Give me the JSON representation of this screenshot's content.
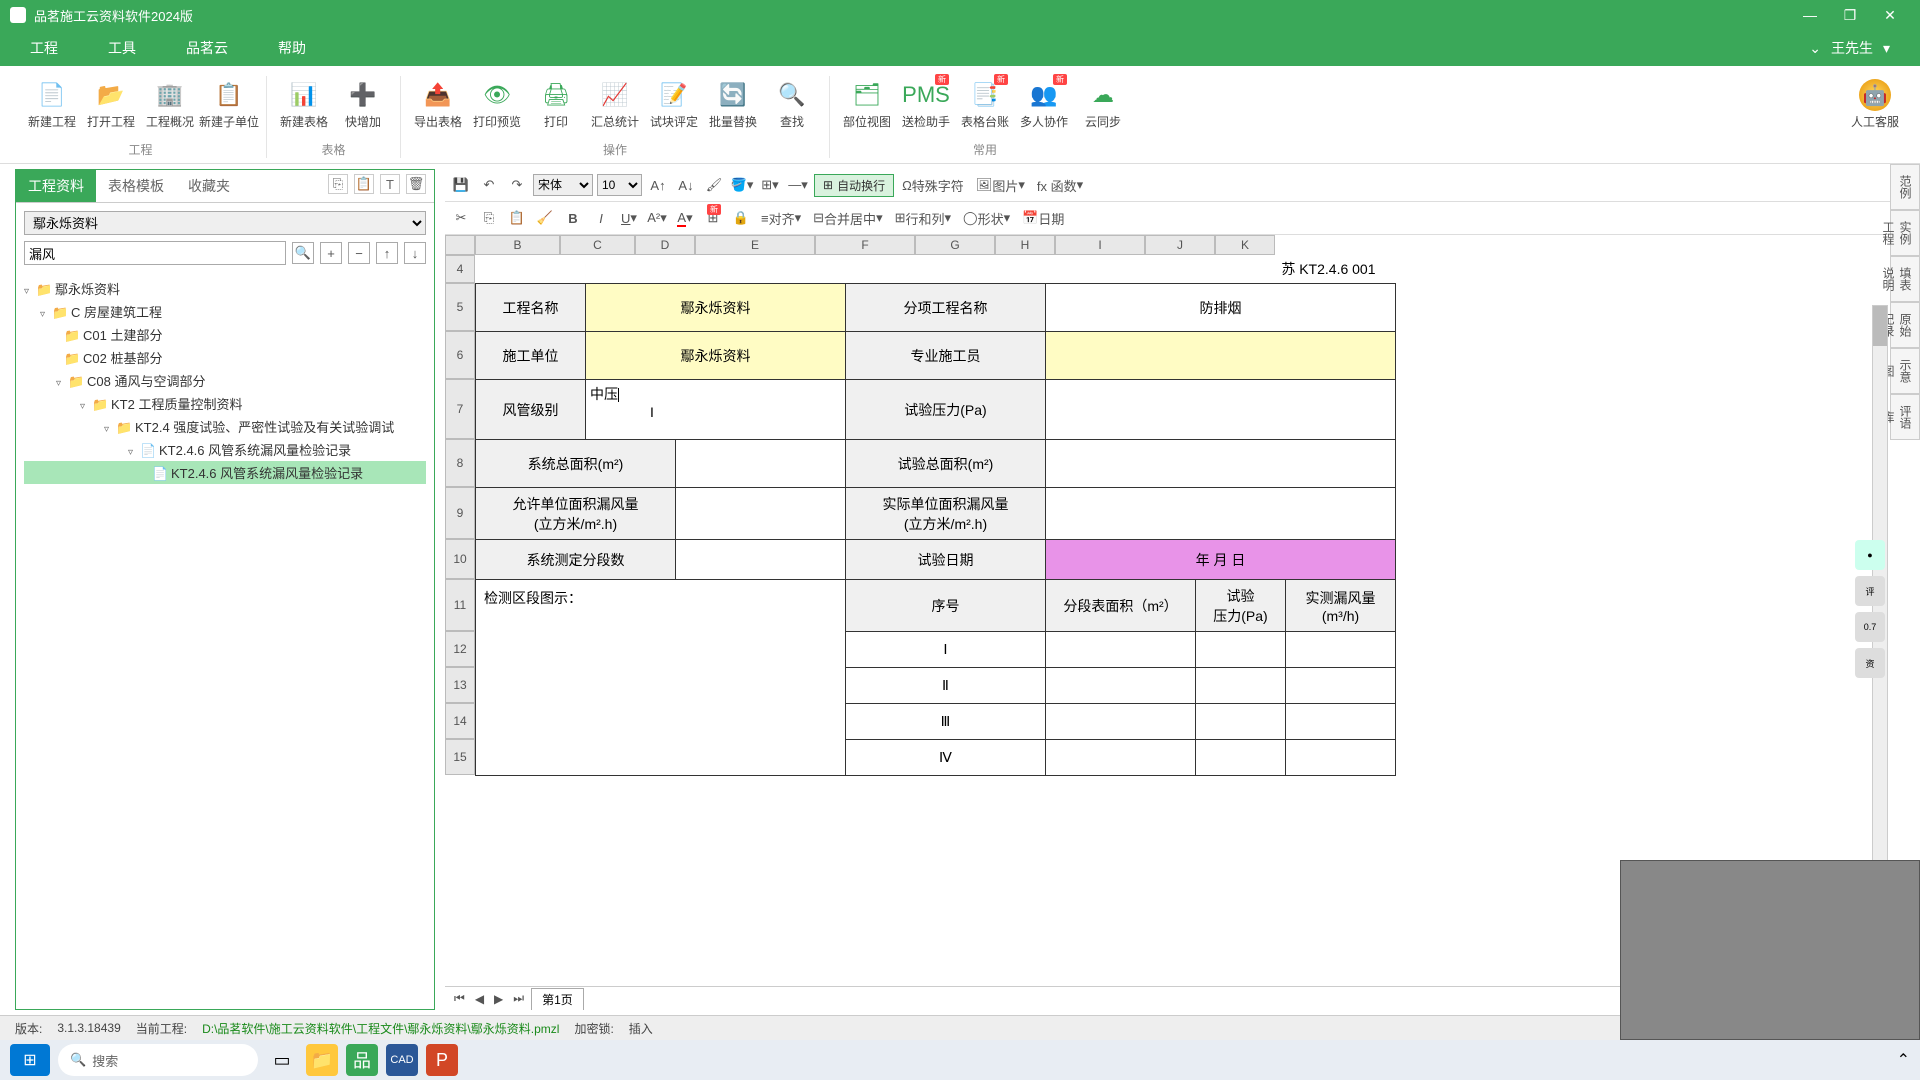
{
  "title": "品茗施工云资料软件2024版",
  "menubar": [
    "工程",
    "工具",
    "品茗云",
    "帮助"
  ],
  "user": "王先生",
  "ribbon": {
    "groups": [
      {
        "label": "工程",
        "items": [
          {
            "icon": "📄",
            "label": "新建工程"
          },
          {
            "icon": "📂",
            "label": "打开工程"
          },
          {
            "icon": "🏢",
            "label": "工程概况"
          },
          {
            "icon": "📋",
            "label": "新建子单位"
          }
        ]
      },
      {
        "label": "表格",
        "items": [
          {
            "icon": "📊",
            "label": "新建表格"
          },
          {
            "icon": "➕",
            "label": "快增加"
          }
        ]
      },
      {
        "label": "操作",
        "items": [
          {
            "icon": "📤",
            "label": "导出表格"
          },
          {
            "icon": "👁",
            "label": "打印预览"
          },
          {
            "icon": "🖨",
            "label": "打印"
          },
          {
            "icon": "📈",
            "label": "汇总统计"
          },
          {
            "icon": "📝",
            "label": "试块评定"
          },
          {
            "icon": "🔄",
            "label": "批量替换"
          },
          {
            "icon": "🔍",
            "label": "查找"
          }
        ]
      },
      {
        "label": "常用",
        "items": [
          {
            "icon": "🗂",
            "label": "部位视图"
          },
          {
            "icon": "PMS",
            "label": "送检助手",
            "badge": "新"
          },
          {
            "icon": "📑",
            "label": "表格台账",
            "badge": "新"
          },
          {
            "icon": "👥",
            "label": "多人协作",
            "badge": "新"
          },
          {
            "icon": "☁",
            "label": "云同步"
          }
        ]
      }
    ],
    "support": "人工客服"
  },
  "side": {
    "tabs": [
      "工程资料",
      "表格模板",
      "收藏夹"
    ],
    "active": 0,
    "select_value": "鄢永烁资料",
    "search_value": "漏风",
    "tree": {
      "root": "鄢永烁资料",
      "n1": "C 房屋建筑工程",
      "n2_1": "C01 土建部分",
      "n2_2": "C02 桩基部分",
      "n2_3": "C08 通风与空调部分",
      "n3": "KT2 工程质量控制资料",
      "n4": "KT2.4 强度试验、严密性试验及有关试验调试",
      "n5": "KT2.4.6 风管系统漏风量检验记录",
      "n6": "KT2.4.6 风管系统漏风量检验记录"
    }
  },
  "toolbar": {
    "font": "宋体",
    "size": "10",
    "autowrap": "自动换行",
    "special": "特殊字符",
    "image": "图片",
    "fx": "fx 函数",
    "align": "对齐",
    "merge": "合并居中",
    "rowcol": "行和列",
    "shape": "形状",
    "date": "日期"
  },
  "cols": [
    "B",
    "C",
    "D",
    "E",
    "F",
    "G",
    "H",
    "I",
    "J",
    "K"
  ],
  "form": {
    "code": "苏 KT2.4.6 001",
    "r5": {
      "h1": "工程名称",
      "v1": "鄢永烁资料",
      "h2": "分项工程名称",
      "v2": "防排烟"
    },
    "r6": {
      "h1": "施工单位",
      "v1": "鄢永烁资料",
      "h2": "专业施工员",
      "v2": ""
    },
    "r7": {
      "h1": "风管级别",
      "v1": "中压",
      "h2": "试验压力(Pa)",
      "v2": ""
    },
    "r8": {
      "h1": "系统总面积(m²)",
      "v1": "",
      "h2": "试验总面积(m²)",
      "v2": ""
    },
    "r9": {
      "h1": "允许单位面积漏风量\n(立方米/m².h)",
      "v1": "",
      "h2": "实际单位面积漏风量\n(立方米/m².h)",
      "v2": ""
    },
    "r10": {
      "h1": "系统测定分段数",
      "v1": "",
      "h2": "试验日期",
      "v2": "年  月  日"
    },
    "r11": {
      "h1": "检测区段图示：",
      "c2": "序号",
      "c3": "分段表面积（m²）",
      "c4": "试验\n压力(Pa)",
      "c5": "实测漏风量\n(m³/h)"
    },
    "seq": [
      "Ⅰ",
      "Ⅱ",
      "Ⅲ",
      "Ⅳ"
    ]
  },
  "sheet_tab": "第1页",
  "status": {
    "ver_label": "版本:",
    "ver": "3.1.3.18439",
    "proj_label": "当前工程:",
    "proj": "D:\\品茗软件\\施工云资料软件\\工程文件\\鄢永烁资料\\鄢永烁资料.pmzl",
    "enc": "加密锁:",
    "mode": "插入"
  },
  "rightbar": [
    "范例",
    "实例\n工程",
    "填表\n说明",
    "原始\n记录",
    "示意\n图",
    "评语\n库"
  ],
  "taskbar_search": "搜索"
}
